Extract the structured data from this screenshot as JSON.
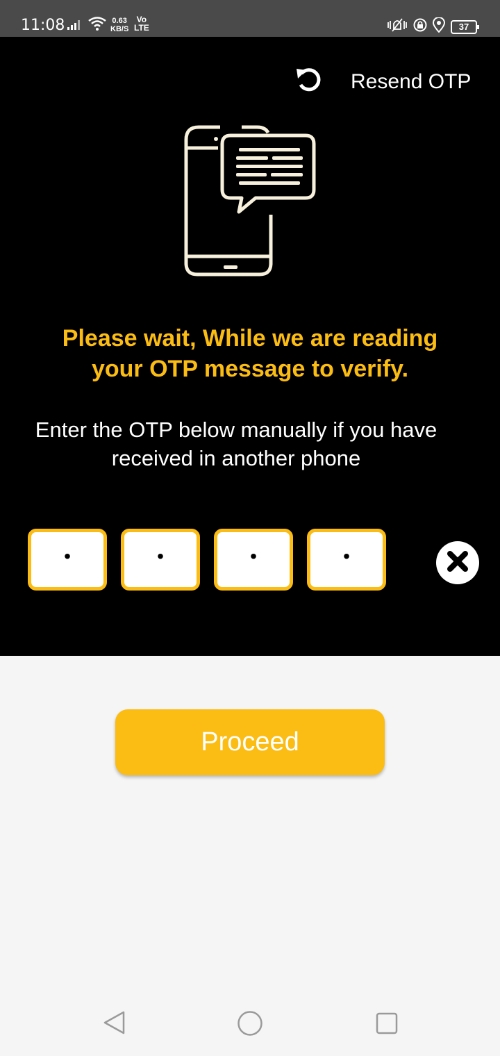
{
  "status_bar": {
    "time": "11:08",
    "speed_value": "0.63",
    "speed_unit": "KB/S",
    "volte_top": "Vo",
    "volte_bottom": "LTE",
    "battery": "37"
  },
  "header": {
    "resend_label": "Resend OTP",
    "resend_icon": "refresh-icon"
  },
  "messages": {
    "wait_line1": "Please wait, While we are reading",
    "wait_line2": "your OTP message to verify.",
    "manual_line1": "Enter the OTP below manually if you have",
    "manual_line2": "received in another phone"
  },
  "otp": {
    "digits": [
      "•",
      "•",
      "•",
      "•"
    ],
    "clear_icon": "close-icon"
  },
  "actions": {
    "proceed_label": "Proceed"
  },
  "colors": {
    "accent": "#fbbc14",
    "panel": "#000000",
    "background": "#f5f5f5"
  }
}
